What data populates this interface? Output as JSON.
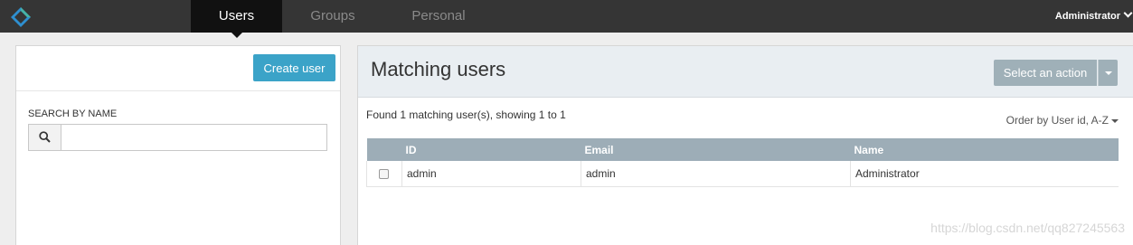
{
  "nav": {
    "logo_icon": "diamond-logo-icon",
    "tabs": [
      {
        "label": "Users",
        "active": true
      },
      {
        "label": "Groups",
        "active": false
      },
      {
        "label": "Personal",
        "active": false
      }
    ],
    "user_menu": {
      "label": "Administrator",
      "icon": "chevron-down-icon"
    }
  },
  "left": {
    "create_button": "Create user",
    "search_label": "SEARCH BY NAME",
    "search_icon": "search-icon",
    "search_value": "",
    "search_placeholder": ""
  },
  "right": {
    "title": "Matching users",
    "action_button": "Select an action",
    "found_text": "Found 1 matching user(s), showing 1 to 1",
    "order_by": "Order by User id, A-Z",
    "table": {
      "columns": [
        "",
        "ID",
        "Email",
        "Name"
      ],
      "rows": [
        {
          "checked": false,
          "id": "admin",
          "email": "admin",
          "name": "Administrator"
        }
      ]
    }
  },
  "watermark": "https://blog.csdn.net/qq827245563",
  "colors": {
    "topbar": "#353535",
    "active_tab": "#111111",
    "primary_button": "#3ba3c8",
    "action_button": "#9fb0b8",
    "table_header": "#9dadb7",
    "panel_header": "#e9eef2"
  }
}
